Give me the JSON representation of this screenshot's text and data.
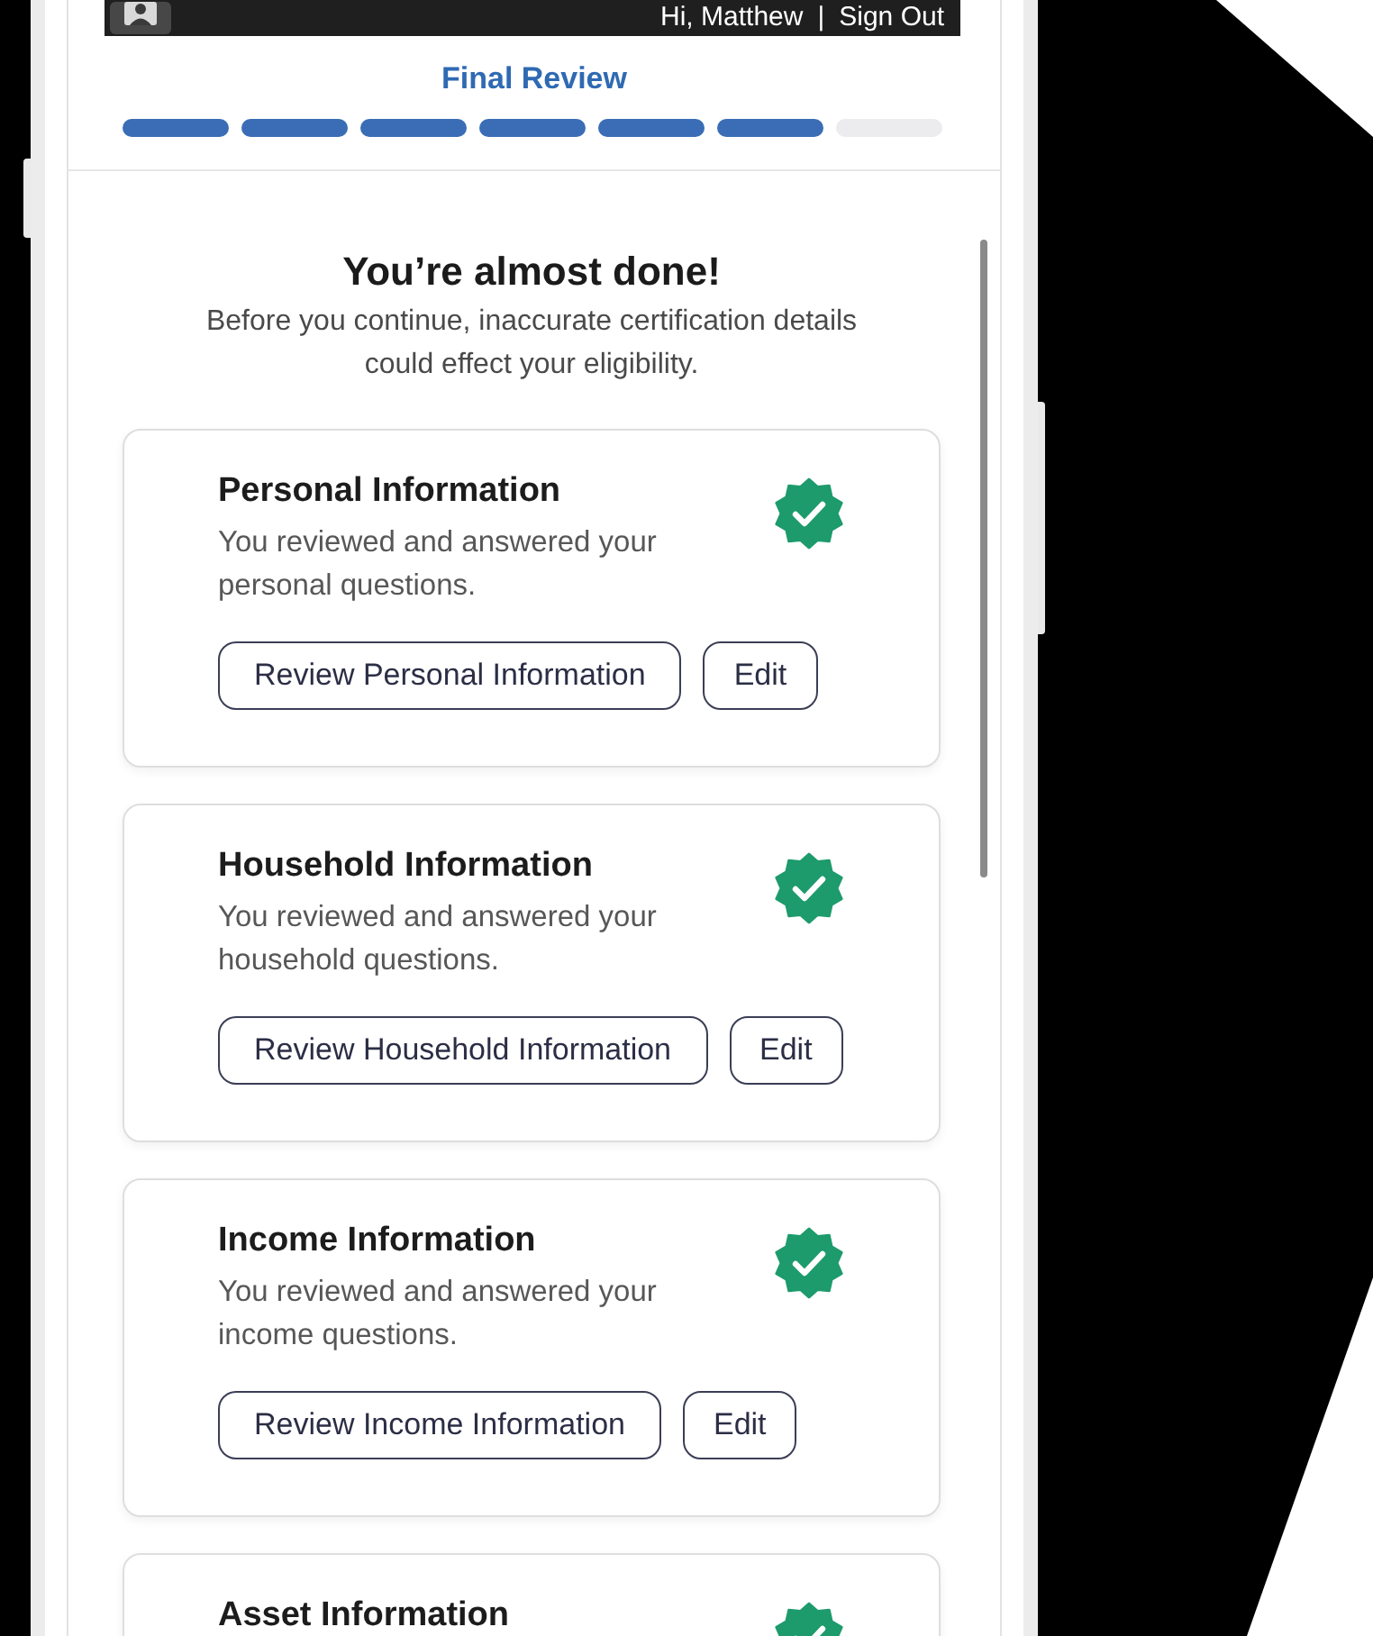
{
  "header": {
    "greeting": "Hi, Matthew",
    "separator": "|",
    "sign_out": "Sign Out"
  },
  "progress": {
    "title": "Final Review",
    "steps": [
      {
        "completed": true
      },
      {
        "completed": true
      },
      {
        "completed": true
      },
      {
        "completed": true
      },
      {
        "completed": true
      },
      {
        "completed": true
      },
      {
        "completed": false
      }
    ]
  },
  "intro": {
    "heading": "You’re almost done!",
    "text": "Before you continue, inaccurate certification details could effect your eligibility."
  },
  "sections": [
    {
      "title": "Personal Information",
      "description": "You reviewed and answered your personal questions.",
      "complete": true,
      "review_button": "Review Personal Information",
      "edit_button": "Edit"
    },
    {
      "title": "Household Information",
      "description": "You reviewed and answered your household questions.",
      "complete": true,
      "review_button": "Review Household Information",
      "edit_button": "Edit"
    },
    {
      "title": "Income Information",
      "description": "You reviewed and answered your income questions.",
      "complete": true,
      "review_button": "Review Income Information",
      "edit_button": "Edit"
    },
    {
      "title": "Asset Information",
      "complete": true
    }
  ]
}
